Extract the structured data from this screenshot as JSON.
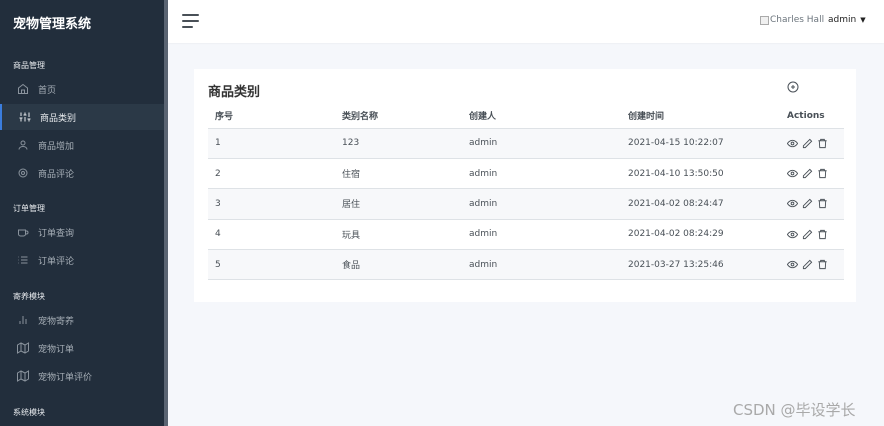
{
  "sidebar": {
    "brand": "宠物管理系统",
    "sections": [
      {
        "title": "商品管理",
        "items": [
          {
            "label": "首页",
            "icon": "home-icon"
          },
          {
            "label": "商品类别",
            "icon": "sliders-icon",
            "active": true
          },
          {
            "label": "商品增加",
            "icon": "user-icon"
          },
          {
            "label": "商品评论",
            "icon": "gear-icon"
          }
        ]
      },
      {
        "title": "订单管理",
        "items": [
          {
            "label": "订单查询",
            "icon": "coffee-icon"
          },
          {
            "label": "订单评论",
            "icon": "list-icon"
          }
        ]
      },
      {
        "title": "寄养模块",
        "items": [
          {
            "label": "宠物寄养",
            "icon": "bar-chart-icon"
          },
          {
            "label": "宠物订单",
            "icon": "map-icon"
          },
          {
            "label": "宠物订单评价",
            "icon": "map-icon"
          }
        ]
      },
      {
        "title": "系统模块",
        "items": []
      }
    ]
  },
  "topbar": {
    "avatar_alt": "Charles Hall",
    "username": "admin"
  },
  "card": {
    "title": "商品类别",
    "columns": [
      "序号",
      "类别名称",
      "创建人",
      "创建时间",
      "Actions"
    ],
    "rows": [
      {
        "id": "1",
        "name": "123",
        "creator": "admin",
        "created": "2021-04-15 10:22:07"
      },
      {
        "id": "2",
        "name": "住宿",
        "creator": "admin",
        "created": "2021-04-10 13:50:50"
      },
      {
        "id": "3",
        "name": "居住",
        "creator": "admin",
        "created": "2021-04-02 08:24:47"
      },
      {
        "id": "4",
        "name": "玩具",
        "creator": "admin",
        "created": "2021-04-02 08:24:29"
      },
      {
        "id": "5",
        "name": "食品",
        "creator": "admin",
        "created": "2021-03-27 13:25:46"
      }
    ]
  },
  "watermark": "CSDN @毕设学长",
  "colors": {
    "sidebar": "#222e3c",
    "accent": "#3b7ddd"
  }
}
